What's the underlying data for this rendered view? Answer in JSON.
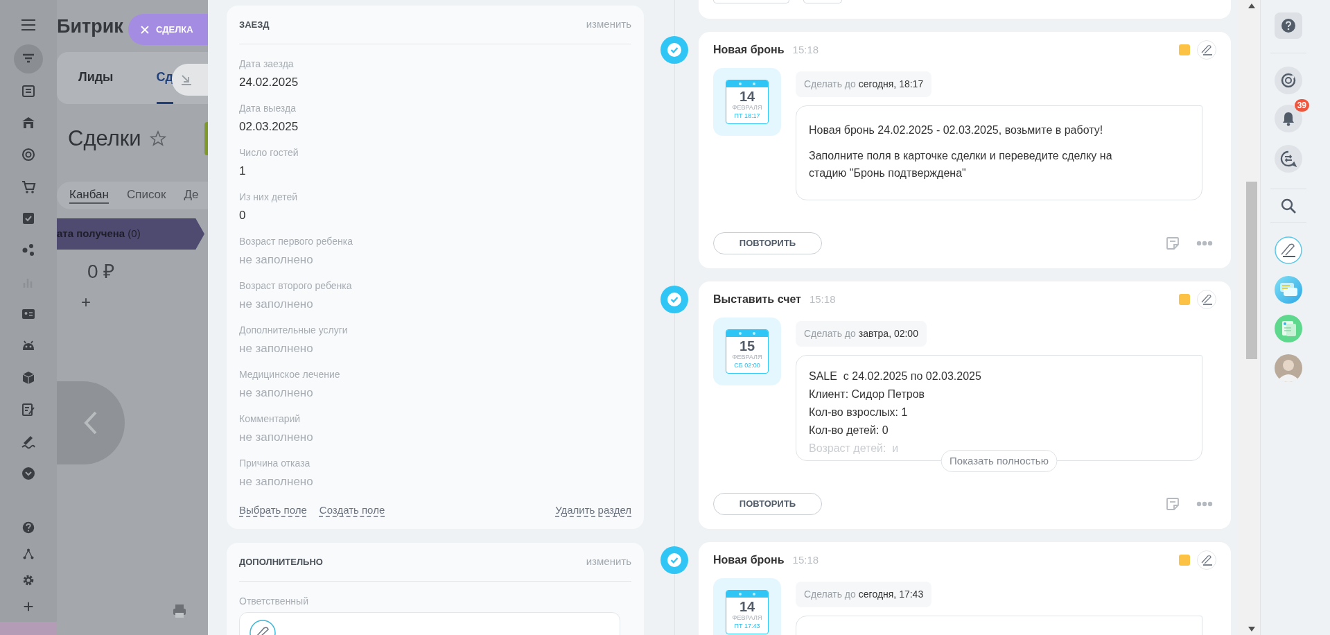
{
  "background_app": {
    "logo": "Битрик",
    "top_tabs": [
      {
        "label": "Лиды",
        "selected": false
      },
      {
        "label": "Сд",
        "selected": true
      }
    ],
    "title": "Сделки",
    "view_tabs": [
      {
        "label": "Канбан",
        "selected": true
      },
      {
        "label": "Список",
        "selected": false
      },
      {
        "label": "Де",
        "selected": false
      }
    ],
    "stage": {
      "name": "ата получена",
      "count": "(0)"
    },
    "sum": "0 ₽",
    "add": "+"
  },
  "close_button": {
    "label": "СДЕЛКА"
  },
  "sections": [
    {
      "title": "ЗАЕЗД",
      "edit": "изменить",
      "fields": [
        {
          "label": "Дата заезда",
          "value": "24.02.2025",
          "filled": true
        },
        {
          "label": "Дата выезда",
          "value": "02.03.2025",
          "filled": true
        },
        {
          "label": "Число гостей",
          "value": "1",
          "filled": true
        },
        {
          "label": "Из них детей",
          "value": "0",
          "filled": true
        },
        {
          "label": "Возраст первого ребенка",
          "value": "не заполнено",
          "filled": false
        },
        {
          "label": "Возраст второго ребенка",
          "value": "не заполнено",
          "filled": false
        },
        {
          "label": "Дополнительные услуги",
          "value": "не заполнено",
          "filled": false
        },
        {
          "label": "Медицинское лечение",
          "value": "не заполнено",
          "filled": false
        },
        {
          "label": "Комментарий",
          "value": "не заполнено",
          "filled": false
        },
        {
          "label": "Причина отказа",
          "value": "не заполнено",
          "filled": false
        }
      ],
      "links": [
        "Выбрать поле",
        "Создать поле"
      ],
      "delete_link": "Удалить раздел"
    },
    {
      "title": "ДОПОЛНИТЕЛЬНО",
      "edit": "изменить",
      "fields": [
        {
          "label": "Ответственный",
          "kind": "user"
        }
      ]
    }
  ],
  "activities": [
    {
      "title": "Новая бронь",
      "time": "15:18",
      "day": "14",
      "month": "ФЕВРАЛЯ",
      "weekday_time": "ПТ 18:17",
      "deadline_label": "Сделать до",
      "deadline": "сегодня, 18:17",
      "paragraphs": [
        "Новая бронь 24.02.2025 - 02.03.2025, возьмите в работу!",
        "Заполните поля в карточке сделки и переведите сделку на стадию \"Бронь подтверждена\""
      ],
      "button": "ПОВТОРИТЬ"
    },
    {
      "title": "Выставить счет",
      "time": "15:18",
      "day": "15",
      "month": "ФЕВРАЛЯ",
      "weekday_time": "СБ 02:00",
      "deadline_label": "Сделать до",
      "deadline": "завтра, 02:00",
      "collapsed": true,
      "lines": [
        "SALE  с 24.02.2025 по 02.03.2025",
        "Клиент: Сидор Петров",
        "Кол-во взрослых: 1",
        "Кол-во детей: 0",
        "Возраст детей:  и"
      ],
      "show_more": "Показать полностью",
      "button": "ПОВТОРИТЬ"
    },
    {
      "title": "Новая бронь",
      "time": "15:18",
      "day": "14",
      "month": "ФЕВРАЛЯ",
      "weekday_time": "ПТ 17:43",
      "deadline_label": "Сделать до",
      "deadline": "сегодня, 17:43"
    }
  ],
  "notifications": {
    "count": "39"
  }
}
